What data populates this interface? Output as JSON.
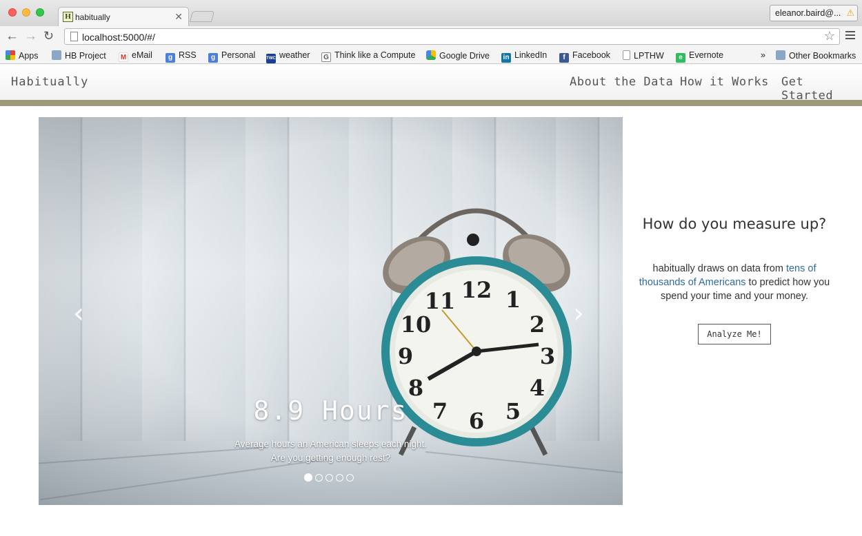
{
  "browser": {
    "tab_title": "habitually",
    "profile_name": "eleanor.baird@...",
    "url": "localhost:5000/#/",
    "bookmarks": [
      {
        "label": "Apps",
        "icon": "apps-grid-icon"
      },
      {
        "label": "HB Project",
        "icon": "folder-icon"
      },
      {
        "label": "eMail",
        "icon": "gmail-icon"
      },
      {
        "label": "RSS",
        "icon": "google-icon"
      },
      {
        "label": "Personal",
        "icon": "google-icon"
      },
      {
        "label": "weather",
        "icon": "weather-channel-icon"
      },
      {
        "label": "Think like a Compute",
        "icon": "page-icon"
      },
      {
        "label": "Google Drive",
        "icon": "drive-icon"
      },
      {
        "label": "LinkedIn",
        "icon": "linkedin-icon"
      },
      {
        "label": "Facebook",
        "icon": "facebook-icon"
      },
      {
        "label": "LPTHW",
        "icon": "page-icon"
      },
      {
        "label": "Evernote",
        "icon": "evernote-icon"
      }
    ],
    "overflow": "»",
    "other_bookmarks": "Other Bookmarks"
  },
  "navbar": {
    "brand": "Habitually",
    "links": [
      "About the Data",
      "How it Works",
      "Get Started"
    ]
  },
  "carousel": {
    "caption_title": "8.9 Hours",
    "caption_line1": "Average hours an American sleeps each night.",
    "caption_line2": "Are you getting enough rest?",
    "slide_count": 5,
    "active_slide": 0
  },
  "side": {
    "title": "How do you measure up?",
    "text_before": "habitually draws on data from ",
    "link_text": "tens of thousands of Americans",
    "text_after": " to predict how you spend your time and your money.",
    "button": "Analyze Me!"
  },
  "colors": {
    "accent_bar": "#9d9978",
    "link": "#2d6a9f"
  }
}
